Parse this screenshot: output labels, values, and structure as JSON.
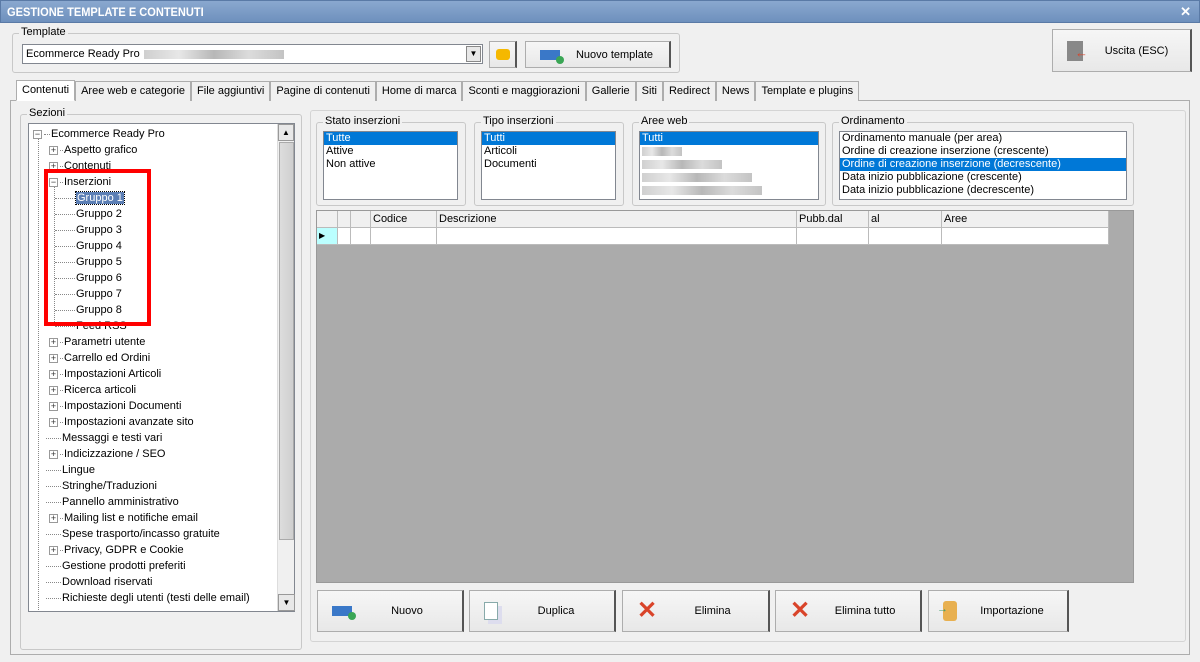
{
  "window": {
    "title": "GESTIONE TEMPLATE E CONTENUTI",
    "close": "✕"
  },
  "template": {
    "group_label": "Template",
    "selected": "Ecommerce Ready Pro",
    "new_button": "Nuovo template",
    "exit_button": "Uscita (ESC)"
  },
  "tabs": [
    {
      "label": "Contenuti",
      "active": true
    },
    {
      "label": "Aree web e categorie"
    },
    {
      "label": "File aggiuntivi"
    },
    {
      "label": "Pagine di contenuti"
    },
    {
      "label": "Home di marca"
    },
    {
      "label": "Sconti e maggiorazioni"
    },
    {
      "label": "Gallerie"
    },
    {
      "label": "Siti"
    },
    {
      "label": "Redirect"
    },
    {
      "label": "News"
    },
    {
      "label": "Template e plugins"
    }
  ],
  "sections": {
    "label": "Sezioni",
    "root": "Ecommerce Ready Pro",
    "items": [
      {
        "label": "Aspetto grafico",
        "level": 1,
        "expander": "plus"
      },
      {
        "label": "Contenuti",
        "level": 1,
        "expander": "plus"
      },
      {
        "label": "Inserzioni",
        "level": 1,
        "expander": "minus"
      },
      {
        "label": "Gruppo 1",
        "level": 2,
        "selected": true
      },
      {
        "label": "Gruppo 2",
        "level": 2
      },
      {
        "label": "Gruppo 3",
        "level": 2
      },
      {
        "label": "Gruppo 4",
        "level": 2
      },
      {
        "label": "Gruppo 5",
        "level": 2
      },
      {
        "label": "Gruppo 6",
        "level": 2
      },
      {
        "label": "Gruppo 7",
        "level": 2
      },
      {
        "label": "Gruppo 8",
        "level": 2
      },
      {
        "label": "Feed RSS",
        "level": 2
      },
      {
        "label": "Parametri utente",
        "level": 1,
        "expander": "plus"
      },
      {
        "label": "Carrello ed Ordini",
        "level": 1,
        "expander": "plus"
      },
      {
        "label": "Impostazioni Articoli",
        "level": 1,
        "expander": "plus"
      },
      {
        "label": "Ricerca articoli",
        "level": 1,
        "expander": "plus"
      },
      {
        "label": "Impostazioni Documenti",
        "level": 1,
        "expander": "plus"
      },
      {
        "label": "Impostazioni avanzate sito",
        "level": 1,
        "expander": "plus"
      },
      {
        "label": "Messaggi e testi vari",
        "level": 1
      },
      {
        "label": "Indicizzazione / SEO",
        "level": 1,
        "expander": "plus"
      },
      {
        "label": "Lingue",
        "level": 1
      },
      {
        "label": "Stringhe/Traduzioni",
        "level": 1
      },
      {
        "label": "Pannello amministrativo",
        "level": 1
      },
      {
        "label": "Mailing list e notifiche email",
        "level": 1,
        "expander": "plus"
      },
      {
        "label": "Spese trasporto/incasso gratuite",
        "level": 1
      },
      {
        "label": "Privacy, GDPR e Cookie",
        "level": 1,
        "expander": "plus"
      },
      {
        "label": "Gestione prodotti preferiti",
        "level": 1
      },
      {
        "label": "Download riservati",
        "level": 1
      },
      {
        "label": "Richieste degli utenti (testi delle email)",
        "level": 1
      }
    ]
  },
  "filters": {
    "stato": {
      "label": "Stato inserzioni",
      "options": [
        "Tutte",
        "Attive",
        "Non attive"
      ],
      "selected": 0
    },
    "tipo": {
      "label": "Tipo inserzioni",
      "options": [
        "Tutti",
        "Articoli",
        "Documenti"
      ],
      "selected": 0
    },
    "aree": {
      "label": "Aree web",
      "options": [
        "Tutti"
      ],
      "selected": 0
    },
    "ordinamento": {
      "label": "Ordinamento",
      "options": [
        "Ordinamento manuale (per area)",
        "Ordine di creazione inserzione (crescente)",
        "Ordine di creazione inserzione (decrescente)",
        "Data inizio pubblicazione (crescente)",
        "Data inizio pubblicazione (decrescente)"
      ],
      "selected": 2
    }
  },
  "grid": {
    "columns": [
      "",
      "",
      "",
      "Codice",
      "Descrizione",
      "Pubb.dal",
      "al",
      "Aree"
    ]
  },
  "actions": [
    {
      "label": "Nuovo",
      "icon": "new-icon"
    },
    {
      "label": "Duplica",
      "icon": "duplicate-icon"
    },
    {
      "label": "Elimina",
      "icon": "delete-icon"
    },
    {
      "label": "Elimina tutto",
      "icon": "delete-all-icon"
    },
    {
      "label": "Importazione",
      "icon": "import-icon"
    }
  ],
  "colors": {
    "selection": "#0078d7",
    "highlight_box": "#ff0000",
    "delete": "#d9442a"
  }
}
